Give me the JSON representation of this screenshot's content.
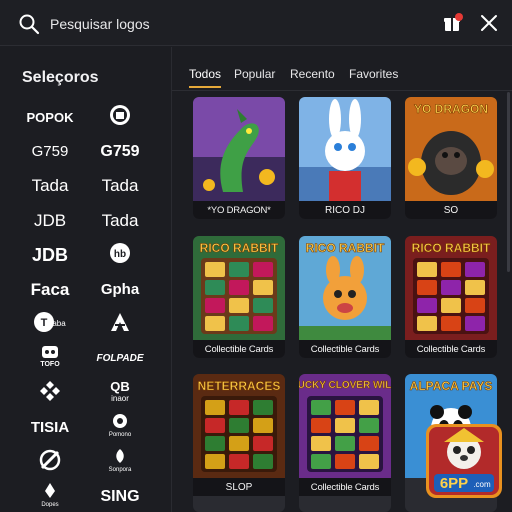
{
  "search": {
    "placeholder": "Pesquisar logos"
  },
  "sidebar": {
    "title": "Seleçoros",
    "providers": [
      {
        "label": "POPOK",
        "icon": ""
      },
      {
        "label": "",
        "icon": "cat-badge-icon"
      },
      {
        "label": "G759",
        "icon": ""
      },
      {
        "label": "G759",
        "icon": ""
      },
      {
        "label": "Tada",
        "icon": ""
      },
      {
        "label": "Tada",
        "icon": ""
      },
      {
        "label": "JDB",
        "icon": ""
      },
      {
        "label": "Tada",
        "icon": ""
      },
      {
        "label": "JDB",
        "icon": ""
      },
      {
        "label": "",
        "icon": "hb-logo-icon"
      },
      {
        "label": "Faca",
        "icon": ""
      },
      {
        "label": "Gpha",
        "icon": ""
      },
      {
        "label": "",
        "icon": "taba-logo-icon"
      },
      {
        "label": "",
        "icon": "a-emblem-icon"
      },
      {
        "label": "",
        "icon": "tofo-logo-icon"
      },
      {
        "label": "FOLPADE",
        "icon": ""
      },
      {
        "label": "",
        "icon": "diamond-cluster-icon"
      },
      {
        "label": "",
        "icon": "qb-inaor-logo-icon"
      },
      {
        "label": "TISIA",
        "icon": ""
      },
      {
        "label": "",
        "icon": "pomono-logo-icon"
      },
      {
        "label": "",
        "icon": "slash-emblem-icon"
      },
      {
        "label": "",
        "icon": "sonpora-logo-icon"
      },
      {
        "label": "",
        "icon": "dopes-logo-icon"
      },
      {
        "label": "SING",
        "icon": ""
      }
    ]
  },
  "tabs": [
    {
      "label": "Todos",
      "active": true
    },
    {
      "label": "Popular",
      "active": false
    },
    {
      "label": "Recento",
      "active": false
    },
    {
      "label": "Favorites",
      "active": false
    }
  ],
  "games": [
    {
      "title": "*YO DRAGON*",
      "banner": "",
      "art": "dragon"
    },
    {
      "title": "RICO DJ",
      "banner": "",
      "art": "rabbit"
    },
    {
      "title": "SO",
      "banner": "YO DRAGON",
      "art": "gorilla"
    },
    {
      "title": "Collectible Cards",
      "banner": "RICO RABBIT",
      "art": "slots-rabbit"
    },
    {
      "title": "Collectible Cards",
      "banner": "RICO RABBIT",
      "art": "rabbit-mascot"
    },
    {
      "title": "Collectible Cards",
      "banner": "RICO RABBIT",
      "art": "slots-rabbit-red"
    },
    {
      "title": "SLOP",
      "banner": "NETERRACES",
      "art": "slots-gold"
    },
    {
      "title": "Collectible Cards",
      "banner": "LUCKY CLOVER WILD",
      "art": "slots-clover"
    },
    {
      "title": "",
      "banner": "ALPACA PAYS",
      "art": "panda"
    }
  ],
  "promo": {
    "label": "6PP",
    "sub": ".com"
  },
  "colors": {
    "accent": "#e6a93a",
    "background": "#1c1d22",
    "notification": "#e53935"
  }
}
